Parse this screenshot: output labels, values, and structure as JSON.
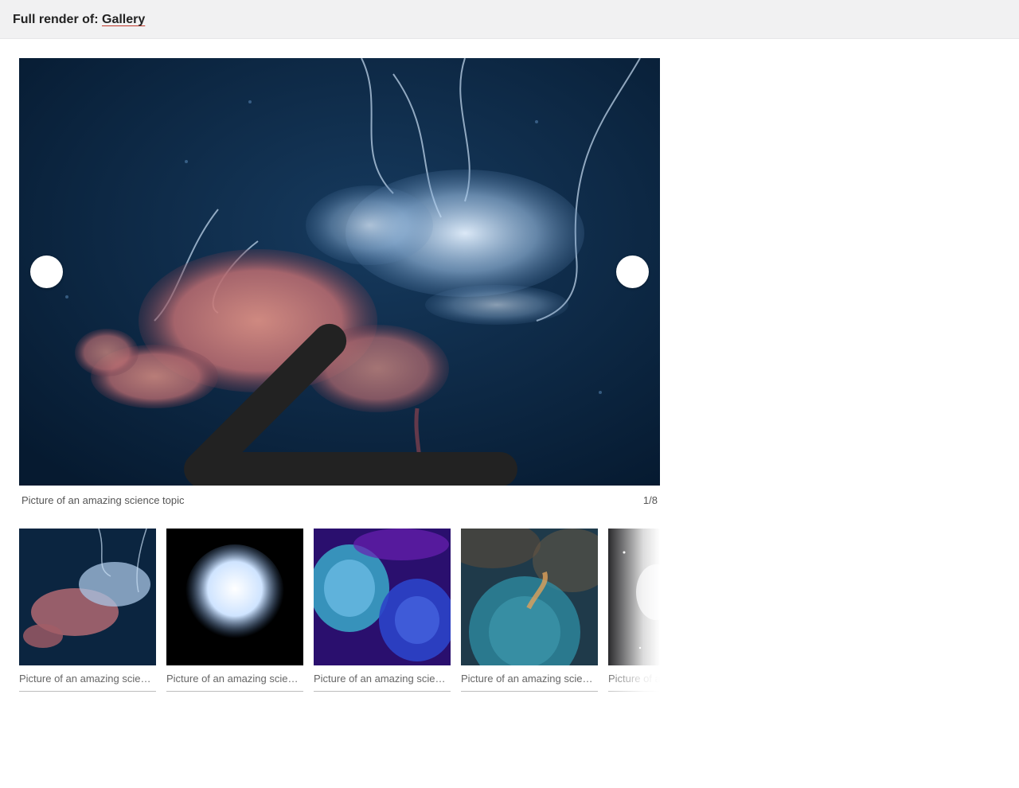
{
  "header": {
    "prefix": "Full render of:",
    "link_label": "Gallery"
  },
  "gallery": {
    "main_caption": "Picture of an amazing science topic",
    "counter": "1/8",
    "prev_icon": "arrow-left-icon",
    "next_icon": "arrow-right-icon",
    "thumbnails": [
      {
        "caption": "Picture of an amazing science topic",
        "subject": "jellyfish"
      },
      {
        "caption": "Picture of an amazing science topic",
        "subject": "white sea urchin"
      },
      {
        "caption": "Picture of an amazing science topic",
        "subject": "fluorescent coral"
      },
      {
        "caption": "Picture of an amazing science topic",
        "subject": "bubble nebula"
      },
      {
        "caption": "Picture of an amazing science topic",
        "subject": "astronaut in space"
      }
    ]
  },
  "colors": {
    "header_bg": "#f1f1f2",
    "link_underline": "#c0392b",
    "stage_bg": "#0b2540"
  }
}
